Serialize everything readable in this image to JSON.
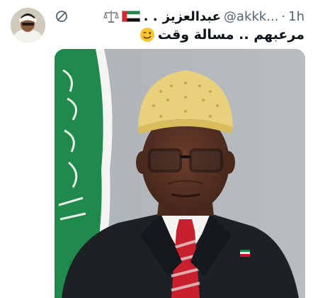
{
  "tweet": {
    "display_name": "عبدالعزيز",
    "handle": "@akkk...",
    "separator": "·",
    "time": "1h",
    "text": "مرعبهم .. مسالة وقت",
    "name_dots": ". ."
  },
  "icons": {
    "more": "more-circle-icon",
    "flag": "uae-flag-icon",
    "scales": "scales-of-justice-icon",
    "emoji": "winking-face-icon"
  },
  "colors": {
    "text_primary": "#0f1419",
    "text_secondary": "#536471",
    "flag_green": "#1f8a4c",
    "somaliland_red": "#c8102e",
    "tie_red": "#c8202c",
    "cap_gold": "#e8d07c"
  }
}
